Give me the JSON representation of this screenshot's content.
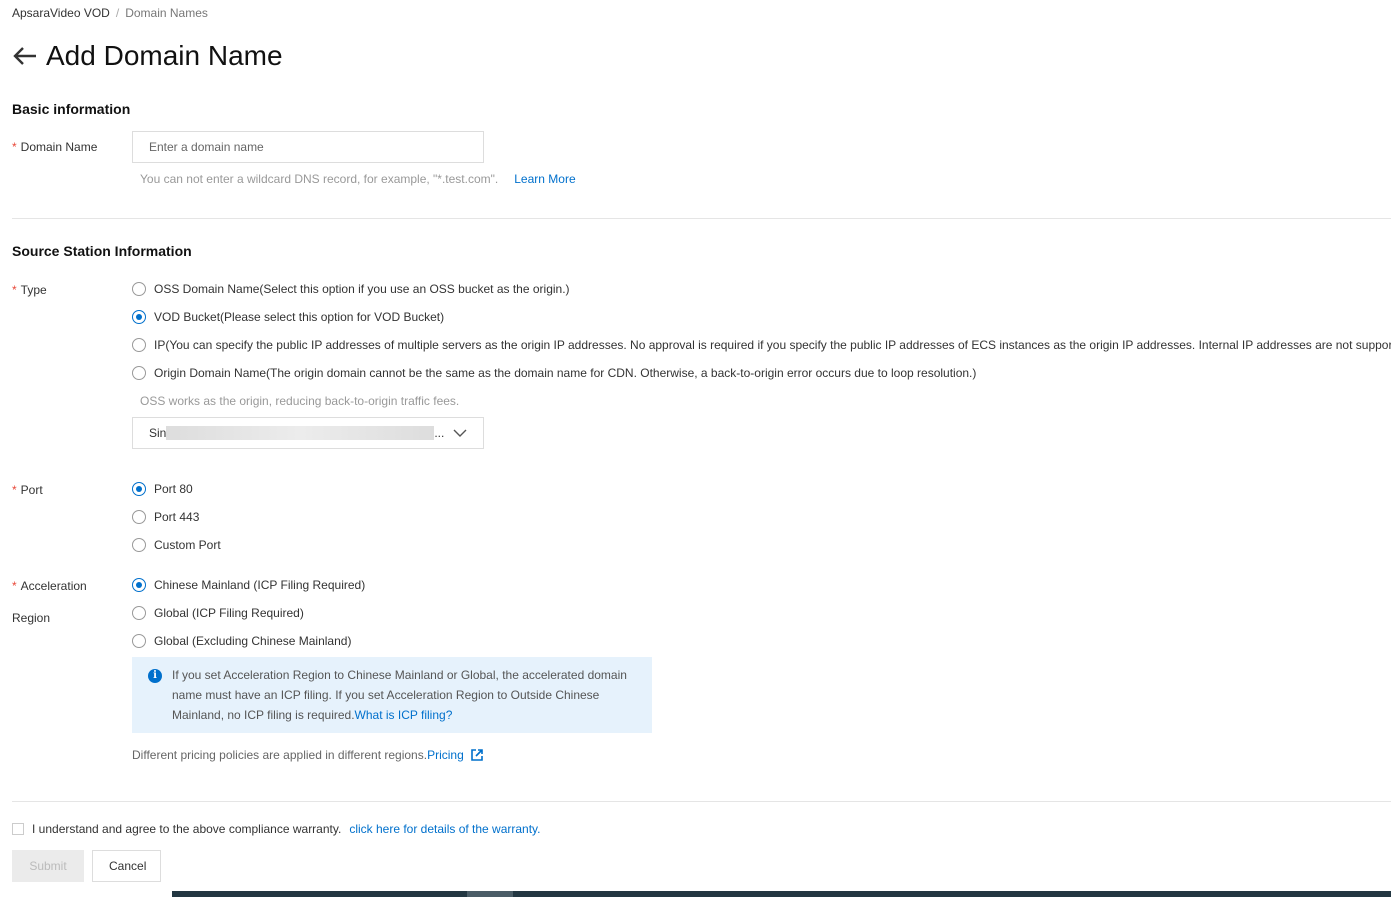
{
  "breadcrumb": {
    "items": [
      "ApsaraVideo VOD",
      "Domain Names"
    ],
    "separator": "/"
  },
  "page": {
    "title": "Add Domain Name"
  },
  "basic": {
    "heading": "Basic information",
    "domain_label": "Domain Name",
    "domain_placeholder": "Enter a domain name",
    "domain_value": "",
    "help": "You can not enter a wildcard DNS record, for example, \"*.test.com\".",
    "learn_more": "Learn More"
  },
  "source": {
    "heading": "Source Station Information",
    "type_label": "Type",
    "types": [
      {
        "name": "OSS Domain Name",
        "desc": "(Select this option if you use an OSS bucket as the origin.)",
        "selected": false
      },
      {
        "name": "VOD Bucket",
        "desc": "(Please select this option for VOD Bucket)",
        "selected": true
      },
      {
        "name": "IP",
        "desc": "(You can specify the public IP addresses of multiple servers as the origin IP addresses. No approval is required if you specify the public IP addresses of ECS instances as the origin IP addresses. Internal IP addresses are not supported.)",
        "selected": false
      },
      {
        "name": "Origin Domain Name",
        "desc": "(The origin domain cannot be the same as the domain name for CDN. Otherwise, a back-to-origin error occurs due to loop resolution.)",
        "selected": false
      }
    ],
    "oss_help": "OSS works as the origin, reducing back-to-origin traffic fees.",
    "bucket_select": {
      "value_prefix": "Sin",
      "ellipsis": "..."
    },
    "port_label": "Port",
    "ports": [
      {
        "label": "Port 80",
        "selected": true
      },
      {
        "label": "Port 443",
        "selected": false
      },
      {
        "label": "Custom Port",
        "selected": false
      }
    ],
    "region_label_1": "Acceleration",
    "region_label_2": "Region",
    "regions": [
      {
        "label": "Chinese Mainland (ICP Filing Required)",
        "selected": true
      },
      {
        "label": "Global (ICP Filing Required)",
        "selected": false
      },
      {
        "label": "Global (Excluding Chinese Mainland)",
        "selected": false
      }
    ],
    "info_text": "If you set Acceleration Region to Chinese Mainland or Global, the accelerated domain name must have an ICP filing. If you set Acceleration Region to Outside Chinese Mainland, no ICP filing is required.",
    "info_link": "What is ICP filing?",
    "pricing_text": "Different pricing policies are applied in different regions.",
    "pricing_link": "Pricing"
  },
  "footer": {
    "agree_text": "I understand and agree to the above compliance warranty.",
    "agree_link": "click here for details of the warranty.",
    "agree_checked": false,
    "submit": "Submit",
    "cancel": "Cancel"
  },
  "colors": {
    "accent": "#0070cc",
    "required": "#e84738",
    "info_bg": "#e6f2fc"
  }
}
